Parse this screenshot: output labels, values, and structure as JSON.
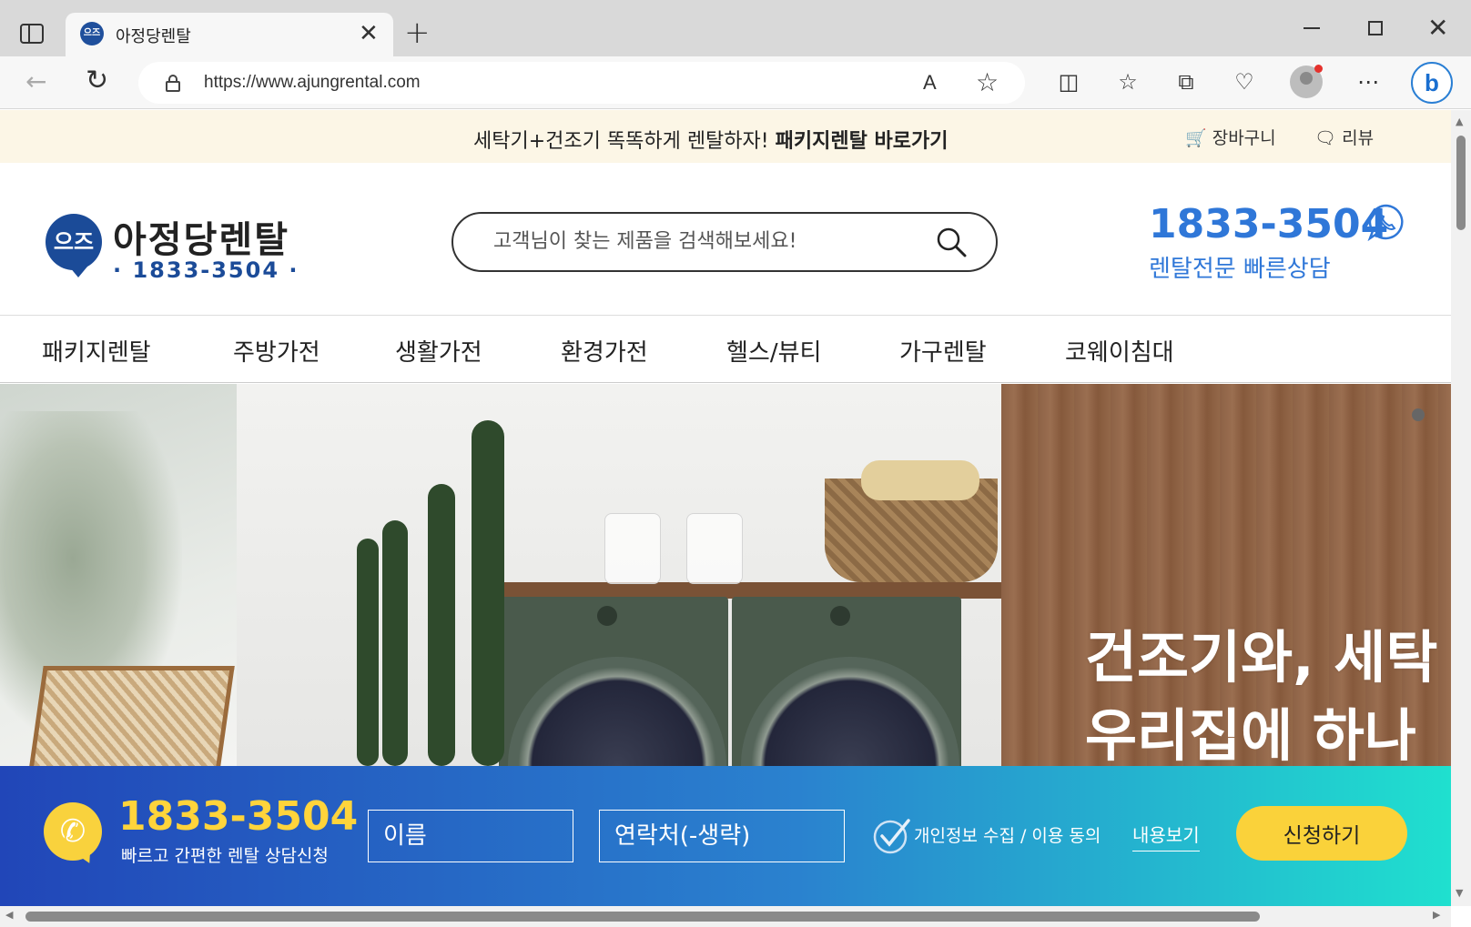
{
  "browser": {
    "tab_title": "아정당렌탈",
    "favicon_text": "으즈",
    "close_glyph": "✕",
    "new_tab_glyph": "+",
    "url": "https://www.ajungrental.com",
    "read_aloud_glyph": "A",
    "window_close_glyph": "✕",
    "icons": [
      "sidebar-icon",
      "back-icon",
      "reload-icon",
      "lock-icon",
      "read-aloud-icon",
      "favorite-star-icon",
      "split-screen-icon",
      "favorites-icon",
      "collections-icon",
      "browser-essentials-icon",
      "profile-icon",
      "more-icon",
      "bing-icon"
    ]
  },
  "top_banner": {
    "message": "세탁기+건조기 똑똑하게 렌탈하자!",
    "link": "패키지렌탈 바로가기",
    "cart": "장바구니",
    "review": "리뷰"
  },
  "header": {
    "logo_mark": "으즈",
    "logo_name": "아정당렌탈",
    "logo_phone": "· 1833-3504 ·",
    "search_placeholder": "고객님이 찾는 제품을 검색해보세요!",
    "phone": "1833-3504",
    "phone_sub": "렌탈전문 빠른상담"
  },
  "nav": {
    "items": [
      "패키지렌탈",
      "주방가전",
      "생활가전",
      "환경가전",
      "헬스/뷰티",
      "가구렌탈",
      "코웨이침대"
    ]
  },
  "hero": {
    "line1": "건조기와, 세탁",
    "line2": "우리집에 하나"
  },
  "consult": {
    "number": "1833-3504",
    "desc": "빠르고 간편한 렌탈 상담신청",
    "name_placeholder": "이름",
    "contact_placeholder": "연락처(-생략)",
    "agree": "개인정보 수집 / 이용 동의",
    "view_terms": "내용보기",
    "apply": "신청하기"
  },
  "colors": {
    "brand_blue": "#1b4b98",
    "phone_blue": "#2f77d8",
    "accent_yellow": "#fad23a",
    "banner_bg": "#fcf6e6"
  }
}
